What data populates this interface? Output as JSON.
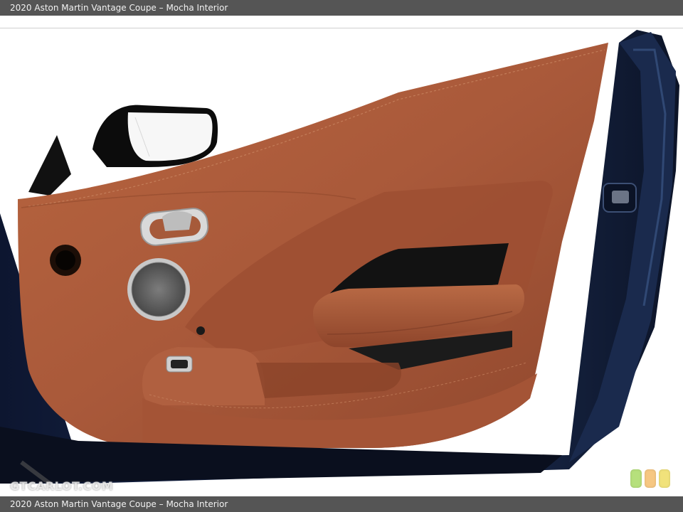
{
  "caption": {
    "top": "2020 Aston Martin Vantage Coupe – Mocha Interior",
    "bottom": "2020 Aston Martin Vantage Coupe – Mocha Interior"
  },
  "watermark": "GTCARLOT.COM",
  "colors": {
    "leather": "#a9593a",
    "leather_dark": "#7e3c25",
    "body_paint": "#14223e",
    "caption_bg": "#555555",
    "dot_green": "#b6e07c",
    "dot_orange": "#f6c782",
    "dot_yellow": "#f1e27b"
  },
  "photo": {
    "subject": "door-panel"
  }
}
